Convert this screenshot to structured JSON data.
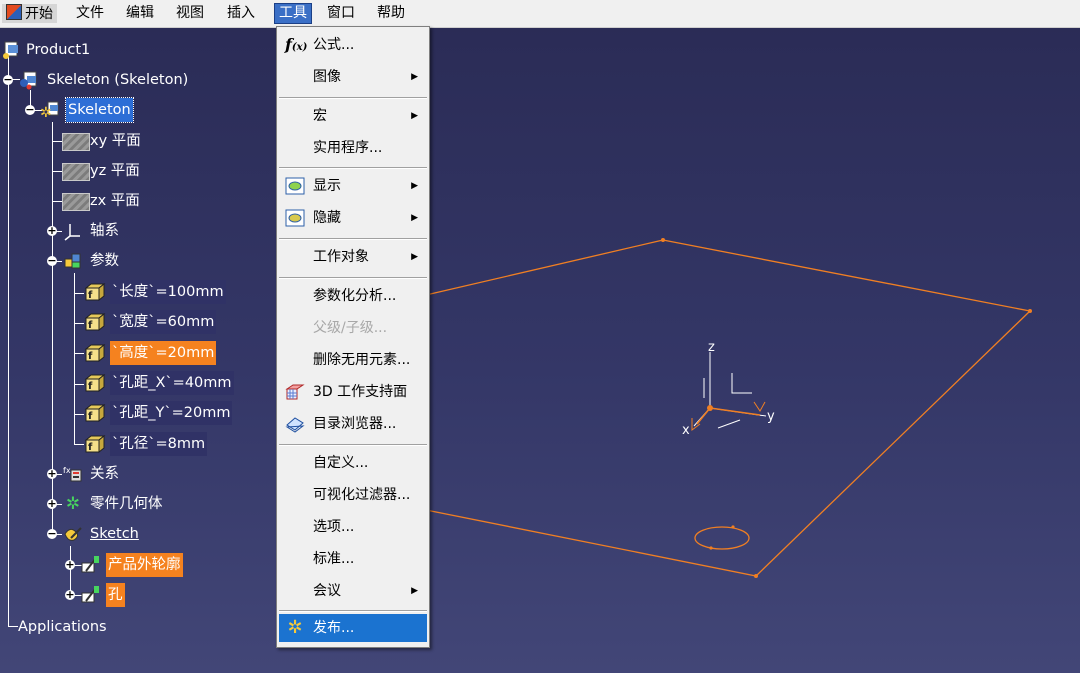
{
  "menubar": {
    "items": [
      "开始",
      "文件",
      "编辑",
      "视图",
      "插入",
      "工具",
      "窗口",
      "帮助"
    ]
  },
  "tree": {
    "product": "Product1",
    "skeleton_root": "Skeleton (Skeleton)",
    "skeleton_part": "Skeleton",
    "planes": [
      "xy 平面",
      "yz 平面",
      "zx 平面"
    ],
    "axis_system": "轴系",
    "parameters_label": "参数",
    "parameters": [
      "`长度`=100mm",
      "`宽度`=60mm",
      "`高度`=20mm",
      "`孔距_X`=40mm",
      "`孔距_Y`=20mm",
      "`孔径`=8mm"
    ],
    "relations": "关系",
    "part_body": "零件几何体",
    "sketch": "Sketch",
    "sketch_children": [
      "产品外轮廓",
      "孔"
    ],
    "applications": "Applications"
  },
  "tools_menu": {
    "items": [
      {
        "label": "公式...",
        "icon": "formula-icon"
      },
      {
        "label": "图像",
        "submenu": true
      },
      {
        "label": "宏",
        "submenu": true
      },
      {
        "label": "实用程序..."
      },
      {
        "label": "显示",
        "submenu": true,
        "icon": "show-icon"
      },
      {
        "label": "隐藏",
        "submenu": true,
        "icon": "hide-icon"
      },
      {
        "label": "工作对象",
        "submenu": true
      },
      {
        "label": "参数化分析..."
      },
      {
        "label": "父级/子级...",
        "disabled": true
      },
      {
        "label": "删除无用元素..."
      },
      {
        "label": "3D 工作支持面",
        "icon": "grid-icon"
      },
      {
        "label": "目录浏览器...",
        "icon": "catalog-icon"
      },
      {
        "label": "自定义..."
      },
      {
        "label": "可视化过滤器..."
      },
      {
        "label": "选项..."
      },
      {
        "label": "标准..."
      },
      {
        "label": "会议",
        "submenu": true
      },
      {
        "label": "发布...",
        "icon": "publish-icon",
        "hover": true
      }
    ]
  },
  "viewport": {
    "axis_labels": {
      "z": "z",
      "y": "y",
      "x": "x"
    },
    "accent_color": "#f07f23"
  }
}
